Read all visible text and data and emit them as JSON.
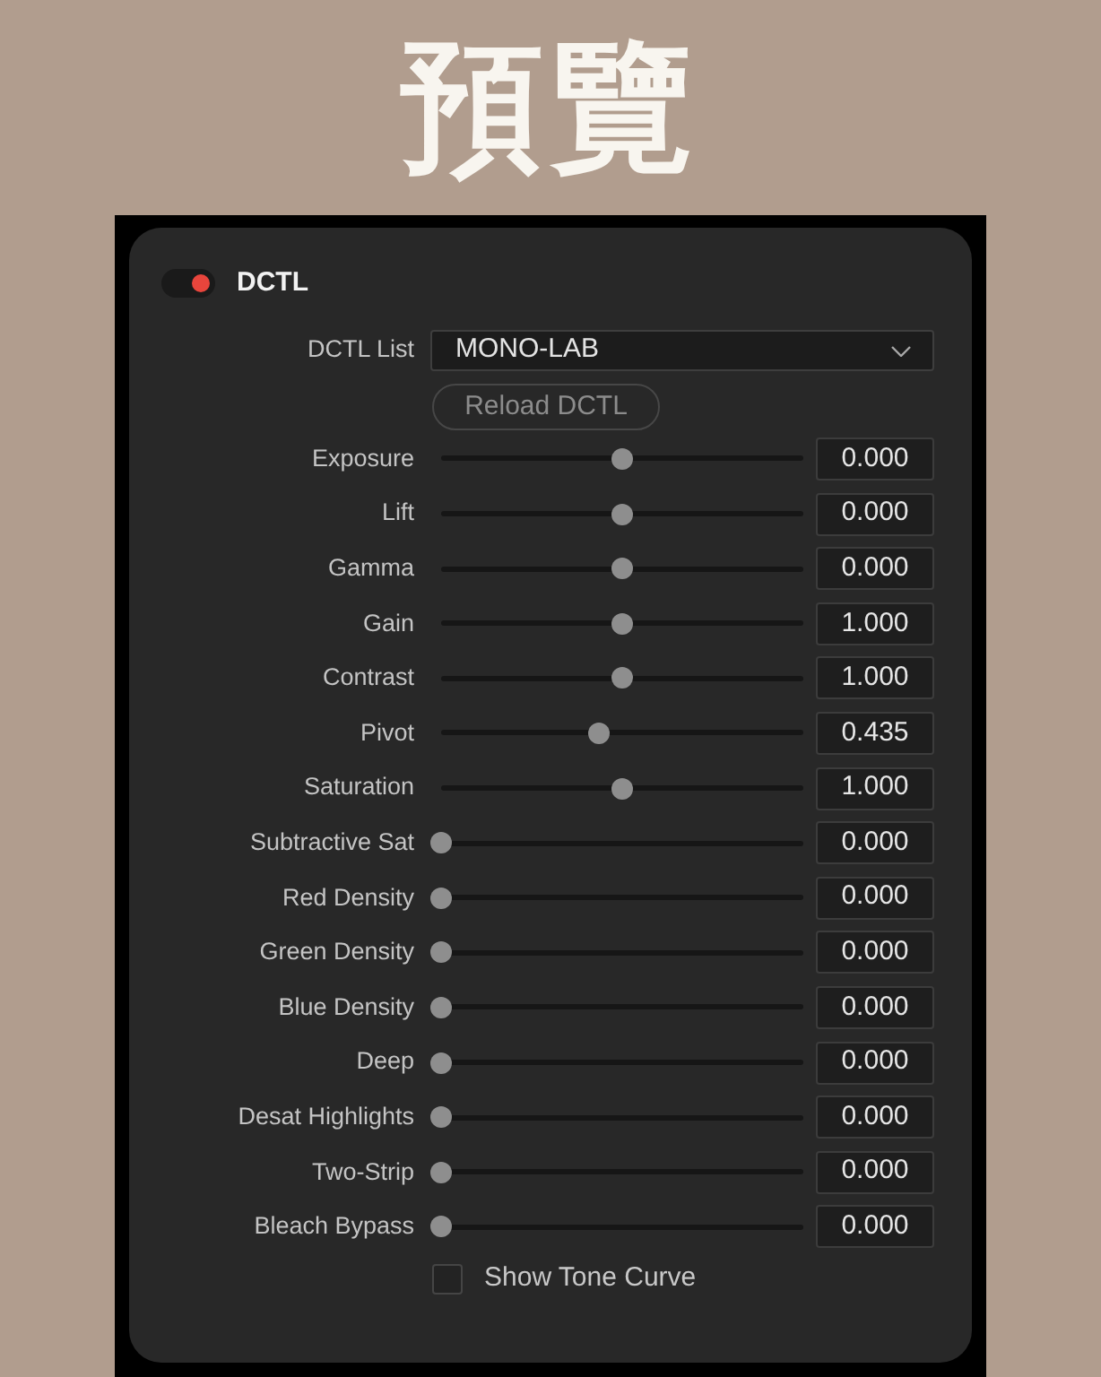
{
  "title": "預覽",
  "panel": {
    "enabled": true,
    "title": "DCTL",
    "dctl_list": {
      "label": "DCTL List",
      "value": "MONO-LAB"
    },
    "reload_button": {
      "label": "Reload DCTL"
    },
    "sliders": [
      {
        "label": "Exposure",
        "level": 0.5,
        "value": "0.000"
      },
      {
        "label": "Lift",
        "level": 0.5,
        "value": "0.000"
      },
      {
        "label": "Gamma",
        "level": 0.5,
        "value": "0.000"
      },
      {
        "label": "Gain",
        "level": 0.5,
        "value": "1.000"
      },
      {
        "label": "Contrast",
        "level": 0.5,
        "value": "1.000"
      },
      {
        "label": "Pivot",
        "level": 0.435,
        "value": "0.435"
      },
      {
        "label": "Saturation",
        "level": 0.5,
        "value": "1.000"
      },
      {
        "label": "Subtractive Sat",
        "level": 0,
        "value": "0.000"
      },
      {
        "label": "Red Density",
        "level": 0,
        "value": "0.000"
      },
      {
        "label": "Green Density",
        "level": 0,
        "value": "0.000"
      },
      {
        "label": "Blue Density",
        "level": 0,
        "value": "0.000"
      },
      {
        "label": "Deep",
        "level": 0,
        "value": "0.000"
      },
      {
        "label": "Desat Highlights",
        "level": 0,
        "value": "0.000"
      },
      {
        "label": "Two-Strip",
        "level": 0,
        "value": "0.000"
      },
      {
        "label": "Bleach Bypass",
        "level": 0,
        "value": "0.000"
      }
    ],
    "show_tone_curve": {
      "label": "Show Tone Curve",
      "checked": false
    }
  }
}
